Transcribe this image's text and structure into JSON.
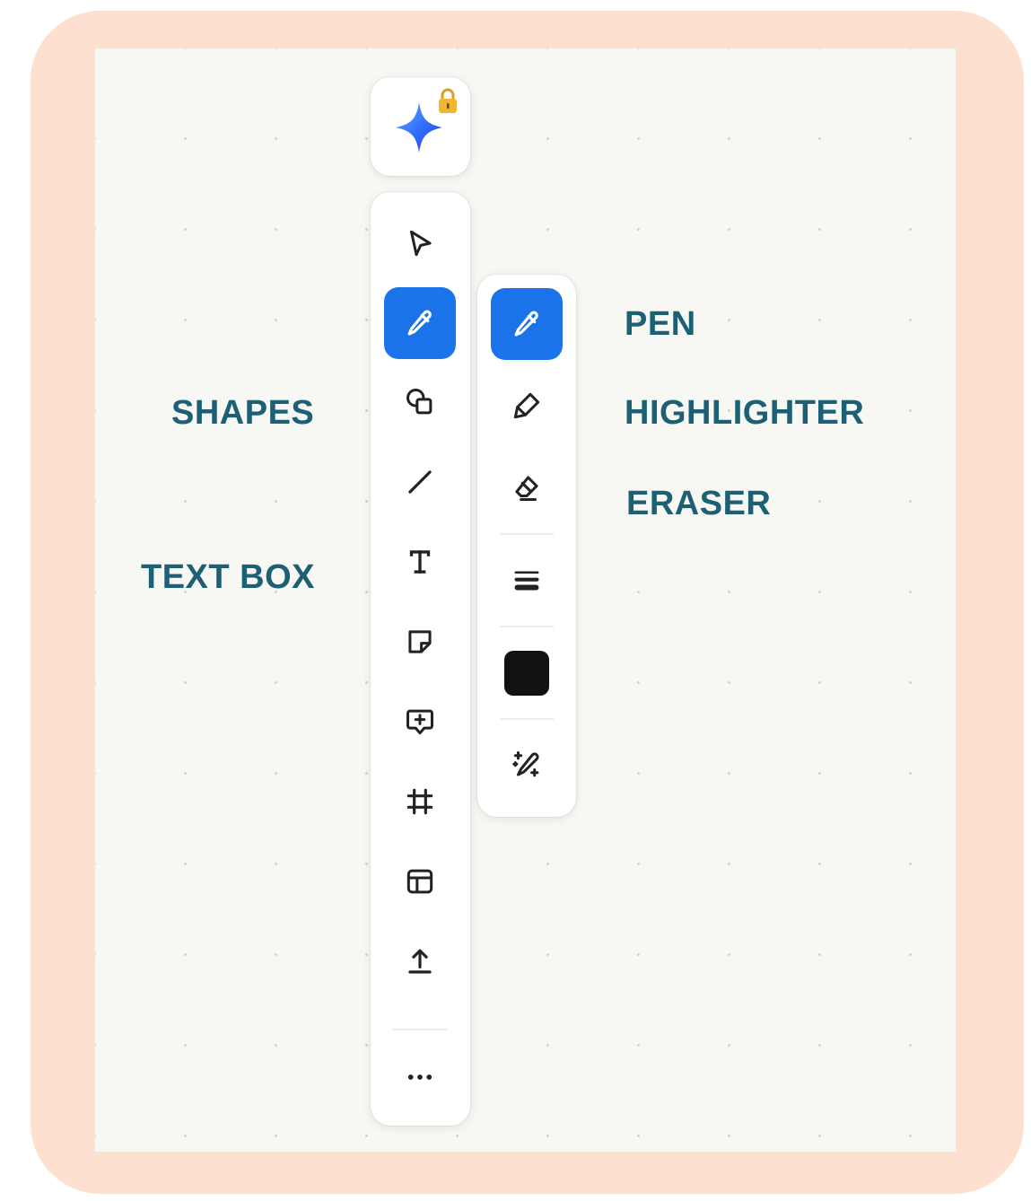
{
  "labels": {
    "shapes": "SHAPES",
    "text_box": "TEXT BOX",
    "pen": "PEN",
    "highlighter": "HIGHLIGHTER",
    "eraser": "ERASER"
  },
  "colors": {
    "frame": "#fde0cf",
    "canvas": "#f7f7f3",
    "accent": "#1a73e8",
    "label_text": "#1d5f75",
    "selected_pen_color": "#111111"
  },
  "main_toolbar": {
    "tools": [
      {
        "icon": "select-arrow-icon"
      },
      {
        "icon": "pen-icon",
        "active": true
      },
      {
        "icon": "shapes-icon"
      },
      {
        "icon": "line-icon"
      },
      {
        "icon": "text-icon"
      },
      {
        "icon": "sticky-note-icon"
      },
      {
        "icon": "comment-icon"
      },
      {
        "icon": "frame-icon"
      },
      {
        "icon": "layout-template-icon"
      },
      {
        "icon": "upload-icon"
      },
      {
        "icon": "more-icon"
      }
    ]
  },
  "pen_toolbar": {
    "tools": [
      {
        "icon": "pen-icon",
        "active": true
      },
      {
        "icon": "highlighter-icon"
      },
      {
        "icon": "eraser-icon"
      },
      {
        "icon": "stroke-width-icon"
      },
      {
        "icon": "color-swatch-icon"
      },
      {
        "icon": "magic-pen-icon"
      }
    ]
  },
  "ai_button": {
    "icon": "ai-sparkle-icon",
    "badge": "lock-icon"
  }
}
